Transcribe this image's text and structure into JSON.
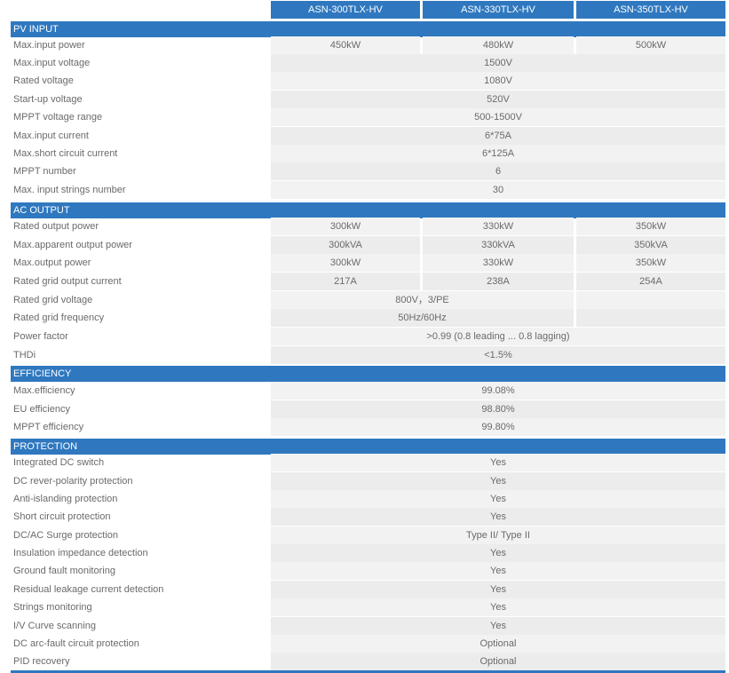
{
  "header": {
    "models": [
      "ASN-300TLX-HV",
      "ASN-330TLX-HV",
      "ASN-350TLX-HV"
    ]
  },
  "sections": [
    {
      "title": "PV INPUT",
      "rows": [
        {
          "label": "Max.input power",
          "values": [
            "450kW",
            "480kW",
            "500kW"
          ]
        },
        {
          "label": "Max.input voltage",
          "shared": "1500V"
        },
        {
          "label": "Rated voltage",
          "shared": "1080V"
        },
        {
          "label": "Start-up voltage",
          "shared": "520V"
        },
        {
          "label": "MPPT voltage range",
          "shared": "500-1500V"
        },
        {
          "label": "Max.input current",
          "shared": "6*75A"
        },
        {
          "label": "Max.short circuit current",
          "shared": "6*125A"
        },
        {
          "label": "MPPT number",
          "shared": "6"
        },
        {
          "label": "Max. input strings number",
          "shared": "30"
        }
      ]
    },
    {
      "title": "AC OUTPUT",
      "rows": [
        {
          "label": "Rated output power",
          "values": [
            "300kW",
            "330kW",
            "350kW"
          ]
        },
        {
          "label": "Max.apparent output power",
          "values": [
            "300kVA",
            "330kVA",
            "350kVA"
          ]
        },
        {
          "label": "Max.output power",
          "values": [
            "300kW",
            "330kW",
            "350kW"
          ]
        },
        {
          "label": "Rated grid output current",
          "values": [
            "217A",
            "238A",
            "254A"
          ]
        },
        {
          "label": "Rated grid voltage",
          "shared12": "800V，3/PE"
        },
        {
          "label": "Rated grid frequency",
          "shared12": "50Hz/60Hz"
        },
        {
          "label": "Power factor",
          "shared": ">0.99 (0.8 leading ... 0.8 lagging)"
        },
        {
          "label": "THDi",
          "shared": "<1.5%"
        }
      ]
    },
    {
      "title": "EFFICIENCY",
      "rows": [
        {
          "label": "Max.efficiency",
          "shared": "99.08%"
        },
        {
          "label": "EU efficiency",
          "shared": "98.80%"
        },
        {
          "label": "MPPT efficiency",
          "shared": "99.80%"
        }
      ]
    },
    {
      "title": "PROTECTION",
      "rows": [
        {
          "label": "Integrated DC switch",
          "shared": "Yes"
        },
        {
          "label": "DC rever-polarity protection",
          "shared": "Yes"
        },
        {
          "label": "Anti-islanding protection",
          "shared": "Yes"
        },
        {
          "label": "Short circuit protection",
          "shared": "Yes"
        },
        {
          "label": "DC/AC Surge protection",
          "shared": "Type II/ Type II"
        },
        {
          "label": "Insulation impedance detection",
          "shared": "Yes"
        },
        {
          "label": "Ground fault monitoring",
          "shared": "Yes"
        },
        {
          "label": "Residual leakage current detection",
          "shared": "Yes"
        },
        {
          "label": "Strings monitoring",
          "shared": "Yes"
        },
        {
          "label": "I/V Curve scanning",
          "shared": "Yes"
        },
        {
          "label": "DC arc-fault circuit protection",
          "shared": "Optional"
        },
        {
          "label": "PID recovery",
          "shared": "Optional"
        }
      ]
    }
  ]
}
